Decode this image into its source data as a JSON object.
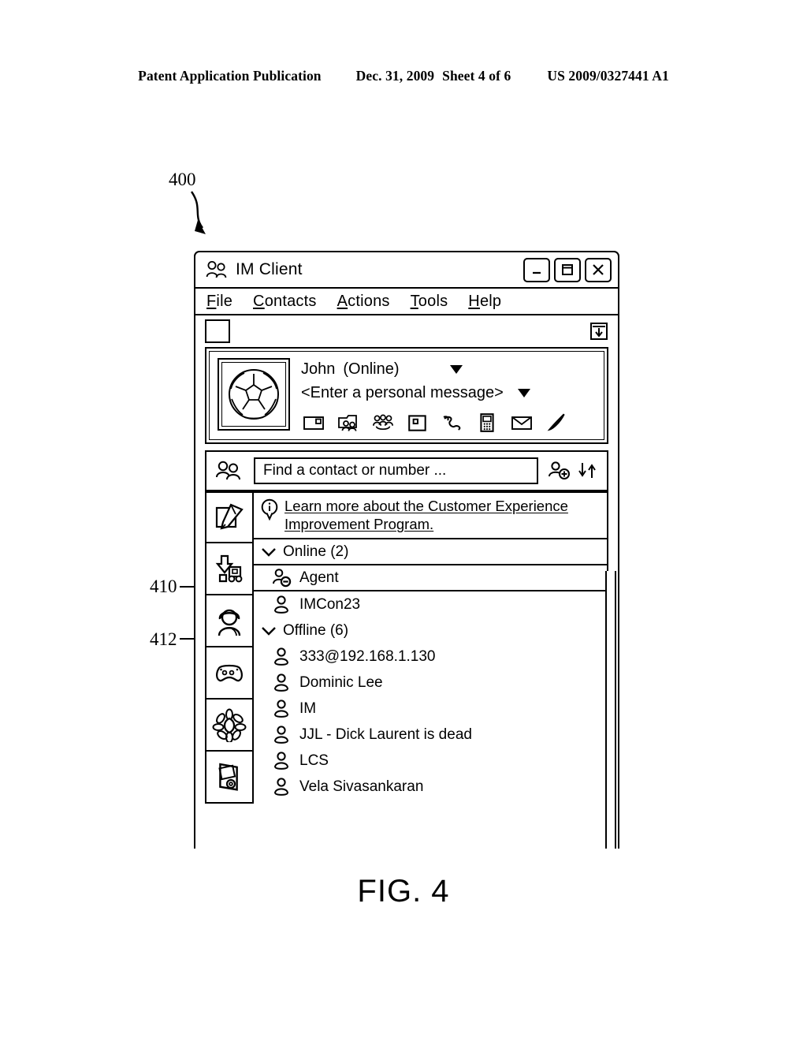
{
  "patent_header": {
    "publication": "Patent Application Publication",
    "date": "Dec. 31, 2009",
    "sheet": "Sheet 4 of 6",
    "number": "US 2009/0327441 A1"
  },
  "figure": {
    "caption": "FIG. 4",
    "reference_numeral": "400",
    "callouts": [
      {
        "id": "410",
        "label": "410"
      },
      {
        "id": "412",
        "label": "412"
      }
    ]
  },
  "window": {
    "title": "IM Client",
    "title_icon": "two-people-icon",
    "controls": {
      "minimize": "minimize-icon",
      "maximize": "maximize-icon",
      "close": "close-icon"
    },
    "menu": [
      {
        "mnemonic": "F",
        "rest": "ile"
      },
      {
        "mnemonic": "C",
        "rest": "ontacts"
      },
      {
        "mnemonic": "A",
        "rest": "ctions"
      },
      {
        "mnemonic": "T",
        "rest": "ools"
      },
      {
        "mnemonic": "H",
        "rest": "elp"
      }
    ],
    "toprow": {
      "blank_button": "blank-square-button",
      "collapse_icon": "download-box-icon"
    }
  },
  "profile": {
    "avatar": "soccer-ball-avatar",
    "user_name": "John",
    "status": "(Online)",
    "personal_message": "<Enter a personal message>",
    "action_icons": [
      "window-card-icon",
      "folder-contacts-icon",
      "group-conference-icon",
      "share-square-icon",
      "phone-handset-icon",
      "mobile-phone-icon",
      "envelope-mail-icon",
      "pen-icon"
    ]
  },
  "search": {
    "left_icon": "contacts-people-icon",
    "placeholder": "Find a contact or number ...",
    "value": "",
    "add_contact_icon": "add-contact-icon",
    "sort_icon": "sort-arrows-icon"
  },
  "sidebar": {
    "items": [
      {
        "icon": "notepad-pencil-icon",
        "name": "notes"
      },
      {
        "icon": "download-toys-icon",
        "name": "downloads"
      },
      {
        "icon": "avatar-person-icon",
        "name": "profile"
      },
      {
        "icon": "game-controller-icon",
        "name": "games"
      },
      {
        "icon": "flower-icon",
        "name": "themes"
      },
      {
        "icon": "media-player-icon",
        "name": "media"
      }
    ]
  },
  "banner": {
    "icon": "info-balloon-icon",
    "line1": "Learn more about the Customer Experience",
    "line2": "Improvement Program."
  },
  "contacts": {
    "groups": [
      {
        "label": "Online (2)",
        "expanded": true,
        "chevron": "chevron-down-icon",
        "members": [
          {
            "name": "Agent",
            "icon": "contact-busy-badge-icon",
            "ruled": true
          },
          {
            "name": "IMCon23",
            "icon": "contact-icon",
            "ruled": false
          }
        ]
      },
      {
        "label": "Offline (6)",
        "expanded": true,
        "chevron": "chevron-down-icon",
        "members": [
          {
            "name": "333@192.168.1.130",
            "icon": "contact-icon",
            "ruled": false
          },
          {
            "name": "Dominic Lee",
            "icon": "contact-icon",
            "ruled": false
          },
          {
            "name": "IM",
            "icon": "contact-icon",
            "ruled": false
          },
          {
            "name": "JJL - Dick Laurent is dead",
            "icon": "contact-icon",
            "ruled": false
          },
          {
            "name": "LCS",
            "icon": "contact-icon",
            "ruled": false
          },
          {
            "name": "Vela Sivasankaran",
            "icon": "contact-icon",
            "ruled": false
          }
        ]
      }
    ]
  }
}
